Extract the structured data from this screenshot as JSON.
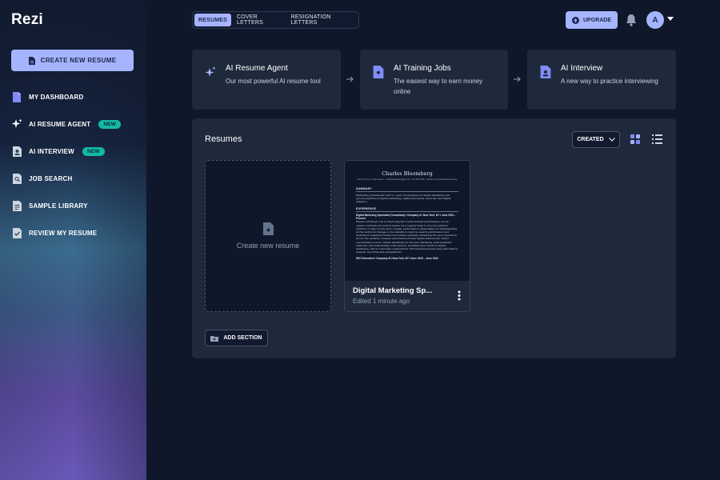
{
  "app": {
    "logo": "Rezi"
  },
  "sidebar": {
    "create_label": "CREATE NEW RESUME",
    "items": [
      {
        "label": "MY DASHBOARD",
        "icon": "document-icon",
        "badge": ""
      },
      {
        "label": "AI RESUME AGENT",
        "icon": "sparkle-icon",
        "badge": "NEW"
      },
      {
        "label": "AI INTERVIEW",
        "icon": "interview-icon",
        "badge": "NEW"
      },
      {
        "label": "JOB SEARCH",
        "icon": "job-search-icon",
        "badge": ""
      },
      {
        "label": "SAMPLE LIBRARY",
        "icon": "library-icon",
        "badge": ""
      },
      {
        "label": "REVIEW MY RESUME",
        "icon": "review-icon",
        "badge": ""
      }
    ]
  },
  "header": {
    "tabs": [
      "RESUMES",
      "COVER LETTERS",
      "RESIGNATION LETTERS"
    ],
    "active_tab": "RESUMES",
    "upgrade_label": "UPGRADE",
    "avatar_initial": "A"
  },
  "features": [
    {
      "title": "AI Resume Agent",
      "desc": "Our most powerful AI resume tool",
      "icon": "sparkle-icon"
    },
    {
      "title": "AI Training Jobs",
      "desc": "The easiest way to earn money online",
      "icon": "training-icon"
    },
    {
      "title": "AI Interview",
      "desc": "A new way to practice interviewing",
      "icon": "interview-icon"
    }
  ],
  "resumes": {
    "title": "Resumes",
    "sort_label": "CREATED",
    "new_card_label": "Create new resume",
    "add_section_label": "ADD SECTION",
    "cards": [
      {
        "title": "Digital Marketing Sp...",
        "subtitle": "Edited 1 minute ago",
        "preview": {
          "name": "Charles Bloomberg",
          "contact": "New York City, United States · charlesbloomberg@rezi.ai · 212-555-0198 · linkedin.com/in/charlesbloomberg",
          "summary_heading": "SUMMARY",
          "summary_text": "Marketing professional with 5+ years of experience in digital marketing and proven expertise in digital marketing, digital innovation, financial, and digital analytics.",
          "experience_heading": "EXPERIENCE",
          "role1": "Digital Marketing Specialist (Consultant) I Company A I New York, NY I June 2021 – Present",
          "role1_text": "Played a strategic role in improving the overall website performance across organic channels and search results via a regular basis to provide optimize solutions to improve the site's organic performance. Responsible for implementing all the technical changes to the website to improve search performance and assisting in designing Facebook business optimally, enhancing the user experience across the websites. Created performance-driven digital frameworks, brand opportunities across content marketing for discrete marketing, built publisher networks, and relationships with vendors. Identified new trends in digital marketing, which could help organizations with brand awareness and performance, analysis, reporting and presentations.",
          "role2": "SEO Executive I Company B I New York, NY I June 2019 – June 2021"
        }
      }
    ]
  }
}
